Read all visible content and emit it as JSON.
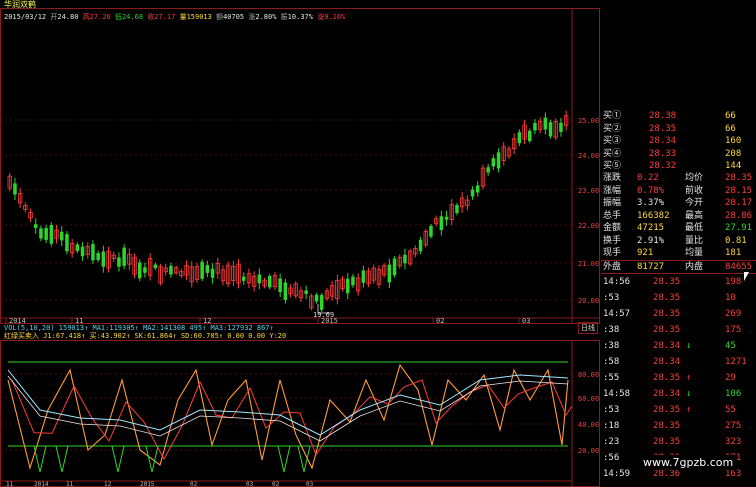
{
  "header": {
    "title": "华润双鹤",
    "date": "2015/03/12",
    "open_label": "开",
    "open": "24.80",
    "high_label": "高",
    "high": "27.26",
    "low_label": "低",
    "low": "24.68",
    "close_label": "收",
    "close": "27.17",
    "volume_label": "量",
    "volume": "159013",
    "amount_label": "额",
    "amount": "40705",
    "change_label": "涨",
    "change": "2.80%",
    "turnover_label": "振",
    "turnover": "10.37%",
    "pct_label": "涨",
    "pct": "9.16%"
  },
  "main_chart": {
    "price_labels": [
      "25.00",
      "24.00",
      "23.00",
      "22.00",
      "21.00",
      "20.00"
    ],
    "low_marker": "19.69",
    "x_labels": [
      "2014",
      "11",
      "12",
      "2015",
      "02",
      "03"
    ],
    "period_button": "日线"
  },
  "indicator_bar": {
    "vol_text": "VOL(5,10,20) 159013↑ MA1:119305↑ MA2:141308 495↑ MA3:127932 867↑",
    "kdj_text": "红绿买卖入 J1:67.418↑ 买:43.902↑ SK:61.864↑ SD:60.705↑ 0.00 0.00 Y:20"
  },
  "indicator_chart": {
    "levels": [
      "80.00",
      "60.00",
      "40.00",
      "20.00"
    ],
    "x_labels": [
      "11",
      "2014",
      "11",
      "12",
      "2015",
      "02",
      "03",
      "02",
      "03"
    ]
  },
  "order_book": {
    "rows": [
      {
        "label": "买①",
        "price": "28.38",
        "vol": "66"
      },
      {
        "label": "买②",
        "price": "28.35",
        "vol": "66"
      },
      {
        "label": "买③",
        "price": "28.34",
        "vol": "160"
      },
      {
        "label": "买④",
        "price": "28.33",
        "vol": "208"
      },
      {
        "label": "买⑤",
        "price": "28.32",
        "vol": "144"
      }
    ]
  },
  "stats": {
    "rows": [
      {
        "l1": "涨跌",
        "v1": "0.22",
        "l2": "均价",
        "v2": "28.35"
      },
      {
        "l1": "涨幅",
        "v1": "0.78%",
        "l2": "前收",
        "v2": "28.15"
      },
      {
        "l1": "振幅",
        "v1": "3.37%",
        "l2": "今开",
        "v2": "28.17"
      },
      {
        "l1": "总手",
        "v1": "166382",
        "l2": "最高",
        "v2": "28.86"
      },
      {
        "l1": "金额",
        "v1": "47215",
        "l2": "最低",
        "v2": "27.91"
      },
      {
        "l1": "换手",
        "v1": "2.91%",
        "l2": "量比",
        "v2": "0.81"
      },
      {
        "l1": "现手",
        "v1": "921",
        "l2": "均量",
        "v2": "181"
      },
      {
        "l1": "外盘",
        "v1": "81727",
        "l2": "内盘",
        "v2": "84655"
      }
    ]
  },
  "ticks": {
    "rows": [
      {
        "time": "14:56",
        "price": "28.35",
        "arrow": "",
        "vol": "198"
      },
      {
        "time": ":53",
        "price": "28.35",
        "arrow": "",
        "vol": "10"
      },
      {
        "time": "14:57",
        "price": "28.35",
        "arrow": "",
        "vol": "269"
      },
      {
        "time": ":38",
        "price": "28.35",
        "arrow": "",
        "vol": "175"
      },
      {
        "time": ":38",
        "price": "28.34",
        "arrow": "↓",
        "vol": "45"
      },
      {
        "time": ":58",
        "price": "28.34",
        "arrow": "",
        "vol": "1271"
      },
      {
        "time": ":55",
        "price": "28.35",
        "arrow": "↑",
        "vol": "29"
      },
      {
        "time": "14:58",
        "price": "28.34",
        "arrow": "↓",
        "vol": "106"
      },
      {
        "time": ":53",
        "price": "28.35",
        "arrow": "↑",
        "vol": "55"
      },
      {
        "time": ":18",
        "price": "28.35",
        "arrow": "",
        "vol": "275"
      },
      {
        "time": ":23",
        "price": "28.35",
        "arrow": "",
        "vol": "323"
      },
      {
        "time": ":56",
        "price": "28.36",
        "arrow": "↑",
        "vol": "171"
      },
      {
        "time": "14:59",
        "price": "28.36",
        "arrow": "",
        "vol": "163"
      }
    ]
  },
  "watermark": "www.7gpzb.com",
  "colors": {
    "up": "#ff3b3b",
    "down": "#2fd52f",
    "price": "#ffd83a",
    "grid": "#8b1a1a"
  }
}
